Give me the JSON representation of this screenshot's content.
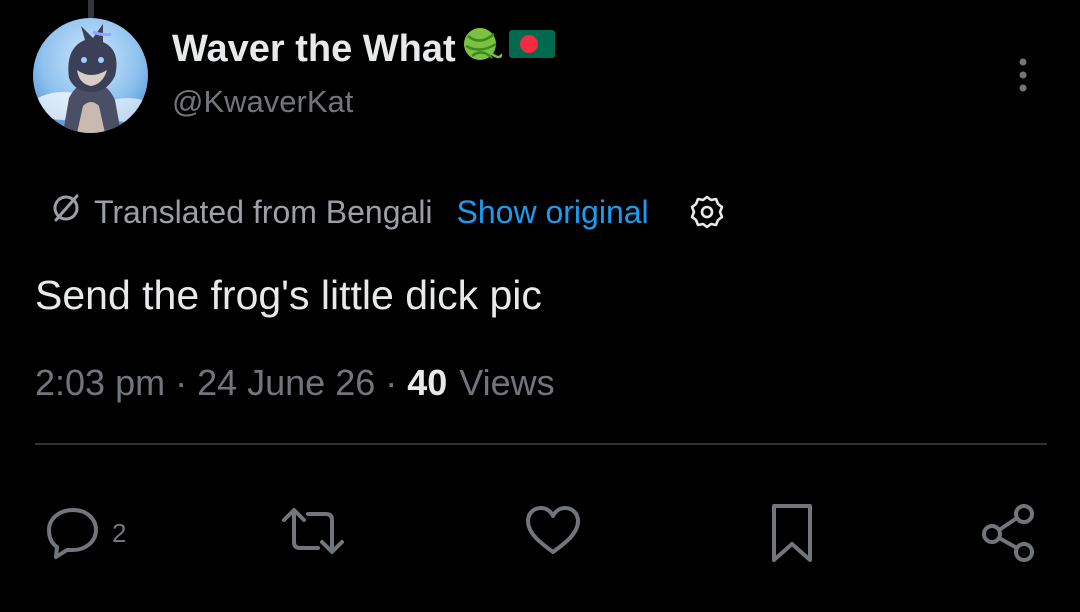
{
  "author": {
    "display_name": "Waver the What",
    "handle": "@KwaverKat",
    "badges": [
      "yarn-ball-emoji",
      "bangladesh-flag-emoji"
    ],
    "avatar": "wolf-character-avatar"
  },
  "translation": {
    "label": "Translated from Bengali",
    "show_original": "Show original"
  },
  "tweet": {
    "text": "Send the frog's little dick pic",
    "time": "2:03 pm",
    "date": "24 June 26",
    "views_count": "40",
    "views_label": "Views"
  },
  "actions": {
    "reply_count": "2",
    "icons": [
      "reply-icon",
      "retweet-icon",
      "like-icon",
      "bookmark-icon",
      "share-icon"
    ]
  },
  "colors": {
    "background": "#000000",
    "primary_text": "#e7e9ea",
    "secondary_text": "#71767b",
    "link": "#1d9bf0",
    "divider": "#2f3336"
  }
}
